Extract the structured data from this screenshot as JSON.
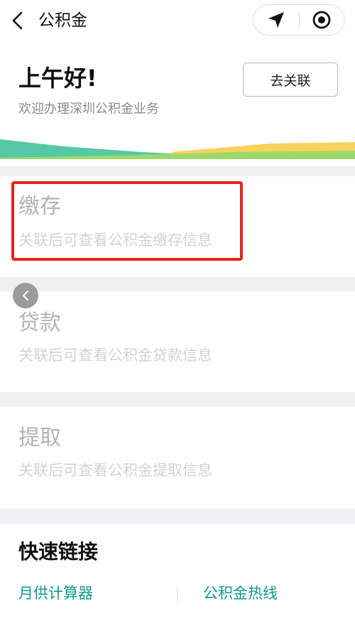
{
  "nav": {
    "title": "公积金",
    "back_icon": "chevron-left-icon",
    "location_icon": "location-arrow-icon",
    "close_icon": "record-circle-icon"
  },
  "header": {
    "greeting": "上午好!",
    "subtitle": "欢迎办理深圳公积金业务",
    "link_button": "去关联",
    "wave_colors": [
      "#55c9a5",
      "#f5d35c",
      "#9fd86a"
    ]
  },
  "cards": [
    {
      "title": "缴存",
      "description": "关联后可查看公积金缴存信息"
    },
    {
      "title": "贷款",
      "description": "关联后可查看公积金贷款信息"
    },
    {
      "title": "提取",
      "description": "关联后可查看公积金提取信息"
    }
  ],
  "quick_links": {
    "title": "快速链接",
    "items": [
      {
        "label": "月供计算器"
      },
      {
        "label": "公积金热线"
      }
    ]
  },
  "colors": {
    "accent": "#0f9a8a",
    "highlight": "#e8231d",
    "background": "#efeff4"
  }
}
